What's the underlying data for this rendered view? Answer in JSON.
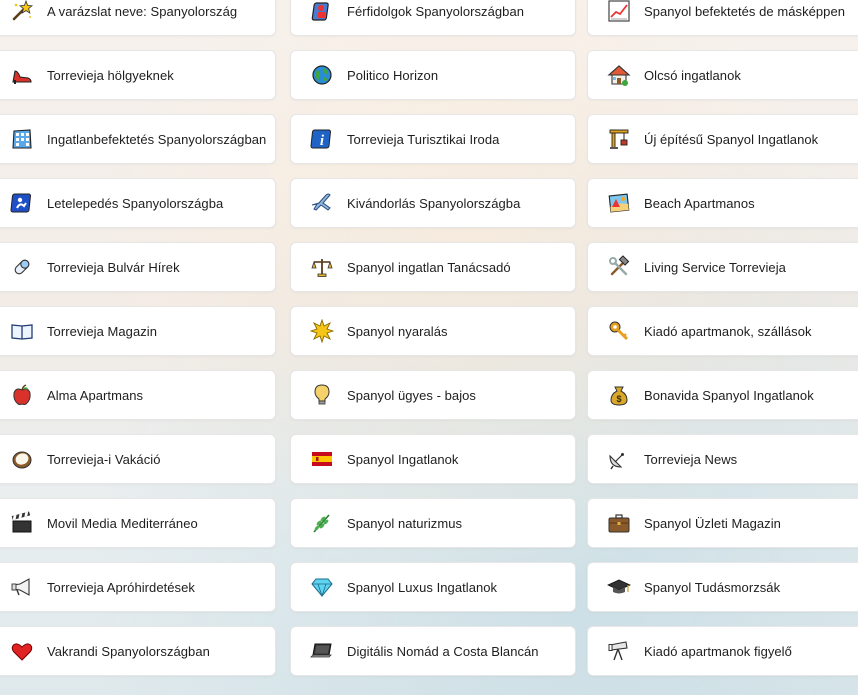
{
  "links": [
    {
      "label": "A varázslat neve: Spanyolország",
      "icon": "magic-wand-icon"
    },
    {
      "label": "Férfidolgok Spanyolországban",
      "icon": "man-icon"
    },
    {
      "label": "Spanyol befektetés de másképpen",
      "icon": "chart-increasing-icon"
    },
    {
      "label": "Torrevieja hölgyeknek",
      "icon": "high-heel-icon"
    },
    {
      "label": "Politico Horizon",
      "icon": "globe-icon"
    },
    {
      "label": "Olcsó ingatlanok",
      "icon": "house-icon"
    },
    {
      "label": "Ingatlanbefektetés Spanyolországban",
      "icon": "office-building-icon"
    },
    {
      "label": "Torrevieja Turisztikai Iroda",
      "icon": "information-icon"
    },
    {
      "label": "Új építésű Spanyol Ingatlanok",
      "icon": "construction-crane-icon"
    },
    {
      "label": "Letelepedés Spanyolországba",
      "icon": "passport-control-icon"
    },
    {
      "label": "Kivándorlás Spanyolországba",
      "icon": "airplane-icon"
    },
    {
      "label": "Beach Apartmanos",
      "icon": "beach-picture-icon"
    },
    {
      "label": "Torrevieja Bulvár Hírek",
      "icon": "pill-icon"
    },
    {
      "label": "Spanyol ingatlan Tanácsadó",
      "icon": "balance-scale-icon"
    },
    {
      "label": "Living Service Torrevieja",
      "icon": "hammer-wrench-icon"
    },
    {
      "label": "Torrevieja Magazin",
      "icon": "open-book-icon"
    },
    {
      "label": "Spanyol nyaralás",
      "icon": "sun-icon"
    },
    {
      "label": "Kiadó apartmanok, szállások",
      "icon": "key-icon"
    },
    {
      "label": "Alma Apartmans",
      "icon": "red-apple-icon"
    },
    {
      "label": "Spanyol ügyes - bajos",
      "icon": "light-bulb-icon"
    },
    {
      "label": "Bonavida Spanyol Ingatlanok",
      "icon": "money-bag-icon"
    },
    {
      "label": "Torrevieja-i Vakáció",
      "icon": "coconut-icon"
    },
    {
      "label": "Spanyol Ingatlanok",
      "icon": "spain-flag-icon"
    },
    {
      "label": "Torrevieja News",
      "icon": "satellite-dish-icon"
    },
    {
      "label": "Movil Media Mediterráneo",
      "icon": "clapper-board-icon"
    },
    {
      "label": "Spanyol naturizmus",
      "icon": "herb-icon"
    },
    {
      "label": "Spanyol Üzleti Magazin",
      "icon": "briefcase-icon"
    },
    {
      "label": "Torrevieja Apróhirdetések",
      "icon": "megaphone-icon"
    },
    {
      "label": "Spanyol Luxus Ingatlanok",
      "icon": "gem-stone-icon"
    },
    {
      "label": "Spanyol Tudásmorzsák",
      "icon": "graduation-cap-icon"
    },
    {
      "label": "Vakrandi Spanyolországban",
      "icon": "red-heart-icon"
    },
    {
      "label": "Digitális Nomád a Costa Blancán",
      "icon": "laptop-icon"
    },
    {
      "label": "Kiadó apartmanok figyelő",
      "icon": "telescope-icon"
    }
  ]
}
